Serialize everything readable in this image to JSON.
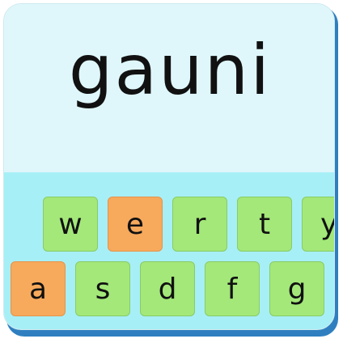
{
  "word": "gauni",
  "keyboard": {
    "row1": [
      {
        "letter": "w",
        "color": "green"
      },
      {
        "letter": "e",
        "color": "orange"
      },
      {
        "letter": "r",
        "color": "green"
      },
      {
        "letter": "t",
        "color": "green"
      },
      {
        "letter": "y",
        "color": "green"
      }
    ],
    "row2": [
      {
        "letter": "a",
        "color": "orange"
      },
      {
        "letter": "s",
        "color": "green"
      },
      {
        "letter": "d",
        "color": "green"
      },
      {
        "letter": "f",
        "color": "green"
      },
      {
        "letter": "g",
        "color": "green"
      }
    ]
  },
  "colors": {
    "green": "#a3e879",
    "orange": "#f7a95c",
    "keyboard_bg": "#a7eff6",
    "word_bg": "#dff7fb"
  }
}
